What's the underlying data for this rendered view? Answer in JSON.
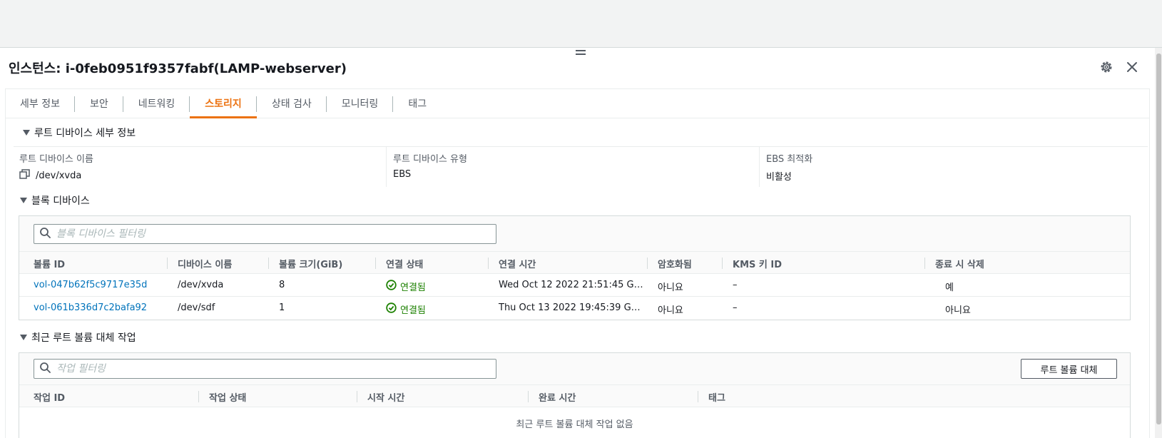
{
  "panel": {
    "title": "인스턴스: i-0feb0951f9357fabf(LAMP-webserver)"
  },
  "tabs": [
    {
      "label": "세부 정보"
    },
    {
      "label": "보안"
    },
    {
      "label": "네트워킹"
    },
    {
      "label": "스토리지",
      "active": true
    },
    {
      "label": "상태 검사"
    },
    {
      "label": "모니터링"
    },
    {
      "label": "태그"
    }
  ],
  "root_device": {
    "section_title": "루트 디바이스 세부 정보",
    "name_label": "루트 디바이스 이름",
    "name_value": "/dev/xvda",
    "type_label": "루트 디바이스 유형",
    "type_value": "EBS",
    "ebs_label": "EBS 최적화",
    "ebs_value": "비활성"
  },
  "block_devices": {
    "section_title": "블록 디바이스",
    "search_placeholder": "블록 디바이스 필터링",
    "columns": [
      "볼륨 ID",
      "디바이스 이름",
      "볼륨 크기(GiB)",
      "연결 상태",
      "연결 시간",
      "암호화됨",
      "KMS 키 ID",
      "종료 시 삭제"
    ],
    "rows": [
      {
        "volume_id": "vol-047b62f5c9717e35d",
        "device": "/dev/xvda",
        "size": "8",
        "status": "연결됨",
        "attach_time": "Wed Oct 12 2022 21:51:45 G…",
        "encrypted": "아니요",
        "kms": "–",
        "delete_on_term": "예"
      },
      {
        "volume_id": "vol-061b336d7c2bafa92",
        "device": "/dev/sdf",
        "size": "1",
        "status": "연결됨",
        "attach_time": "Thu Oct 13 2022 19:45:39 G…",
        "encrypted": "아니요",
        "kms": "–",
        "delete_on_term": "아니요"
      }
    ]
  },
  "replace_tasks": {
    "section_title": "최근 루트 볼륨 대체 작업",
    "search_placeholder": "작업 필터링",
    "button_label": "루트 볼륨 대체",
    "columns": [
      "작업 ID",
      "작업 상태",
      "시작 시간",
      "완료 시간",
      "태그"
    ],
    "empty_text": "최근 루트 볼륨 대체 작업 없음"
  },
  "colors": {
    "accent": "#ec7211",
    "link": "#0073bb",
    "success": "#1d8102"
  },
  "icons": [
    "gear-icon",
    "close-icon",
    "copy-icon",
    "search-icon",
    "check-circle-icon",
    "caret-down-icon",
    "drag-handle-icon"
  ]
}
